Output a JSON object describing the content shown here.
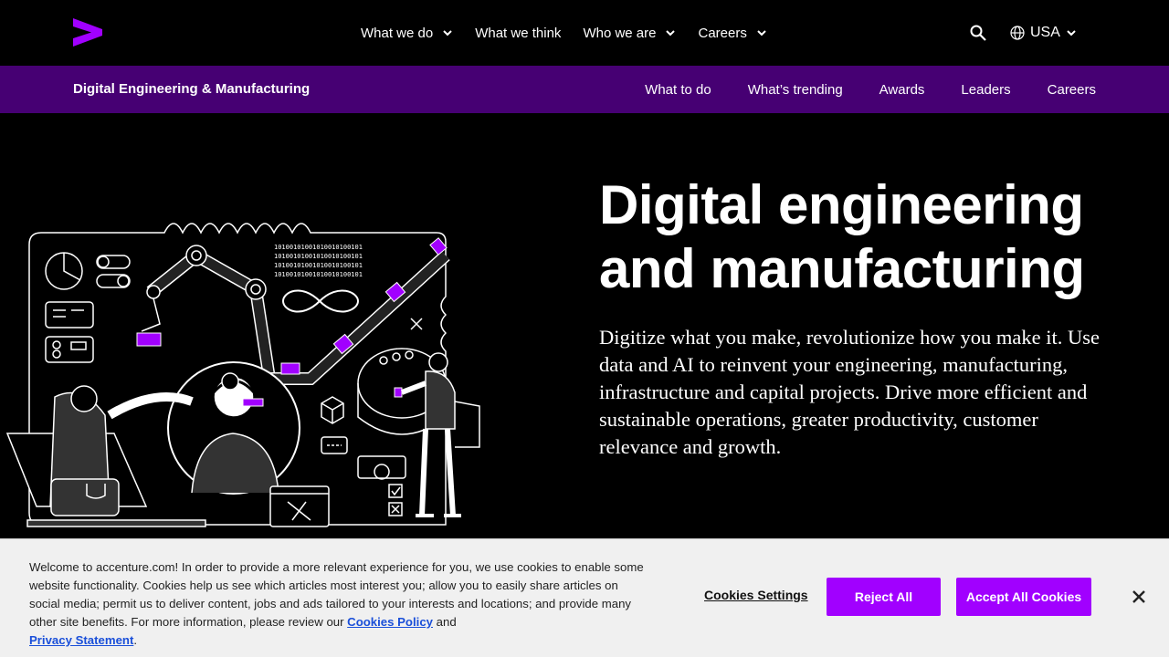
{
  "colors": {
    "accent": "#a100ff",
    "subnav_bg": "#460073",
    "cookie_bg": "#f0f0f0",
    "link": "#1a4fd9"
  },
  "header": {
    "logo_icon": "accenture-greater-than-logo",
    "nav": [
      {
        "label": "What we do",
        "has_dropdown": true
      },
      {
        "label": "What we think",
        "has_dropdown": false
      },
      {
        "label": "Who we are",
        "has_dropdown": true
      },
      {
        "label": "Careers",
        "has_dropdown": true
      }
    ],
    "locale": "USA"
  },
  "subnav": {
    "title": "Digital Engineering & Manufacturing",
    "links": [
      "What to do",
      "What’s trending",
      "Awards",
      "Leaders",
      "Careers"
    ]
  },
  "hero": {
    "title_line1": "Digital engineering",
    "title_line2": "and manufacturing",
    "description": "Digitize what you make, revolutionize how you make it. Use data and AI to reinvent your engineering, manufacturing, infrastructure and capital projects. Drive more efficient and sustainable operations, greater productivity, customer relevance and growth.",
    "binary_text": "10100101001010010100101"
  },
  "cookie_banner": {
    "text": "Welcome to accenture.com! In order to provide a more relevant experience for you, we use cookies to enable some website functionality. Cookies help us see which articles most interest you; allow you to easily share articles on social media; permit us to deliver content, jobs and ads tailored to your interests and locations; and provide many other site benefits. For more information, please review our ",
    "cookies_policy_label": "Cookies Policy",
    "and_text": " and ",
    "privacy_label": "Privacy Statement",
    "end_text": ".",
    "settings_label": "Cookies Settings",
    "reject_label": "Reject All",
    "accept_label": "Accept All Cookies"
  }
}
